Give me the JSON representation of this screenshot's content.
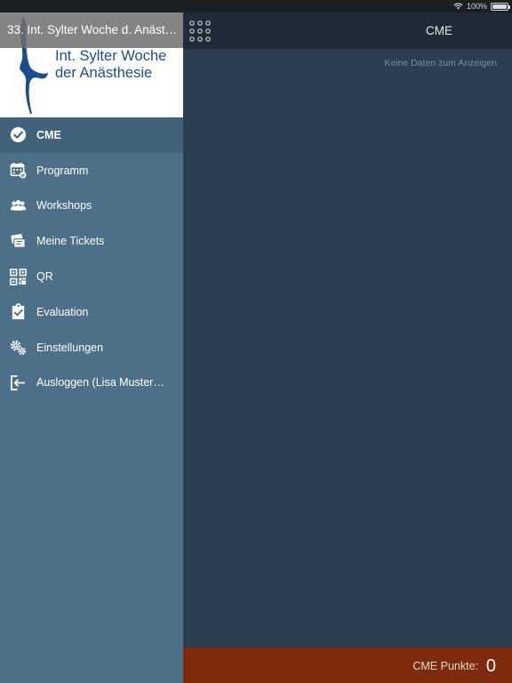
{
  "status_bar": {
    "battery_text": "100%"
  },
  "sidebar": {
    "event_title": "33. Int. Sylter Woche d. Anäst…",
    "logo_line1": "Int. Sylter Woche",
    "logo_line2": "der Anästhesie",
    "items": [
      {
        "label": "CME",
        "icon": "checkmark-circle-icon",
        "active": true
      },
      {
        "label": "Programm",
        "icon": "calendar-icon",
        "active": false
      },
      {
        "label": "Workshops",
        "icon": "group-icon",
        "active": false
      },
      {
        "label": "Meine Tickets",
        "icon": "tickets-icon",
        "active": false
      },
      {
        "label": "QR",
        "icon": "qr-code-icon",
        "active": false
      },
      {
        "label": "Evaluation",
        "icon": "clipboard-check-icon",
        "active": false
      },
      {
        "label": "Einstellungen",
        "icon": "gears-icon",
        "active": false
      },
      {
        "label": "Ausloggen (Lisa Musterm…",
        "icon": "logout-icon",
        "active": false
      }
    ]
  },
  "header": {
    "title": "CME"
  },
  "main": {
    "empty_message": "Keine Daten zum Anzeigen"
  },
  "footer": {
    "points_label": "CME Punkte:",
    "points_value": "0"
  },
  "colors": {
    "sidebar_bg": "#4d7089",
    "sidebar_active": "#40627b",
    "main_bg": "#2c3e50",
    "topbar_bg": "#1f2b36",
    "footer_bg": "#7d2a0d",
    "logo_blue": "#1c4d8a"
  }
}
